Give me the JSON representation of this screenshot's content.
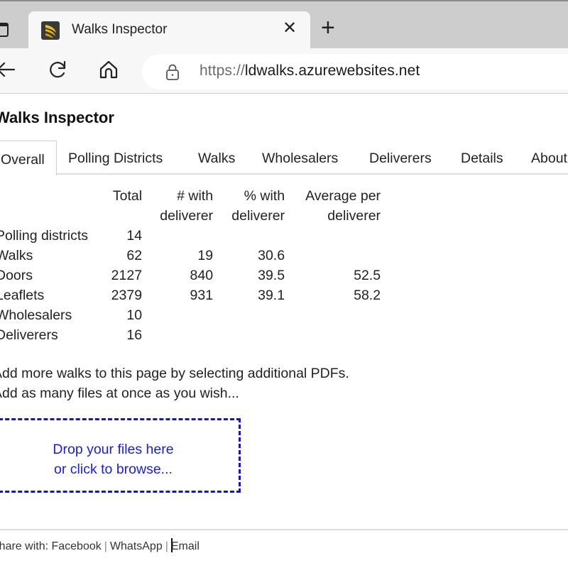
{
  "browser": {
    "tab_title": "Walks Inspector",
    "url_scheme": "https://",
    "url_host": "ldwalks.azurewebsites.net",
    "icons": {
      "tab_overview": "tab-overview-icon",
      "favicon": "walks-inspector-logo",
      "close_tab": "close-icon",
      "new_tab": "plus-icon",
      "back": "back-arrow-icon",
      "reload": "reload-icon",
      "home": "home-icon",
      "lock": "lock-icon"
    },
    "close_glyph": "✕",
    "new_tab_glyph": "+"
  },
  "page": {
    "title": "Walks Inspector",
    "tabs": [
      {
        "label": "Overall",
        "active": true
      },
      {
        "label": "Polling Districts",
        "active": false
      },
      {
        "label": "Walks",
        "active": false
      },
      {
        "label": "Wholesalers",
        "active": false
      },
      {
        "label": "Deliverers",
        "active": false
      },
      {
        "label": "Details",
        "active": false
      },
      {
        "label": "About",
        "active": false
      }
    ],
    "stats_table": {
      "headers": [
        "",
        "Total",
        "# with deliverer",
        "% with deliverer",
        "Average per deliverer"
      ],
      "header_lines": {
        "total": [
          "Total",
          ""
        ],
        "with": [
          "# with",
          "deliverer"
        ],
        "pct": [
          "% with",
          "deliverer"
        ],
        "avg": [
          "Average per",
          "deliverer"
        ]
      },
      "rows": [
        {
          "label": "Polling districts",
          "total": "14",
          "with": "",
          "pct": "",
          "avg": ""
        },
        {
          "label": "Walks",
          "total": "62",
          "with": "19",
          "pct": "30.6",
          "avg": ""
        },
        {
          "label": "Doors",
          "total": "2127",
          "with": "840",
          "pct": "39.5",
          "avg": "52.5"
        },
        {
          "label": "Leaflets",
          "total": "2379",
          "with": "931",
          "pct": "39.1",
          "avg": "58.2"
        },
        {
          "label": "Wholesalers",
          "total": "10",
          "with": "",
          "pct": "",
          "avg": ""
        },
        {
          "label": "Deliverers",
          "total": "16",
          "with": "",
          "pct": "",
          "avg": ""
        }
      ]
    },
    "info_lines": [
      "Add more walks to this page by selecting additional PDFs.",
      "Add as many files at once as you wish..."
    ],
    "dropzone": {
      "line1": "Drop your files here",
      "line2": "or click to browse...",
      "color": "#1010ee"
    },
    "share": {
      "prefix": "Share with: ",
      "links": [
        "Facebook",
        "WhatsApp",
        "Email"
      ],
      "separator": "|"
    }
  }
}
